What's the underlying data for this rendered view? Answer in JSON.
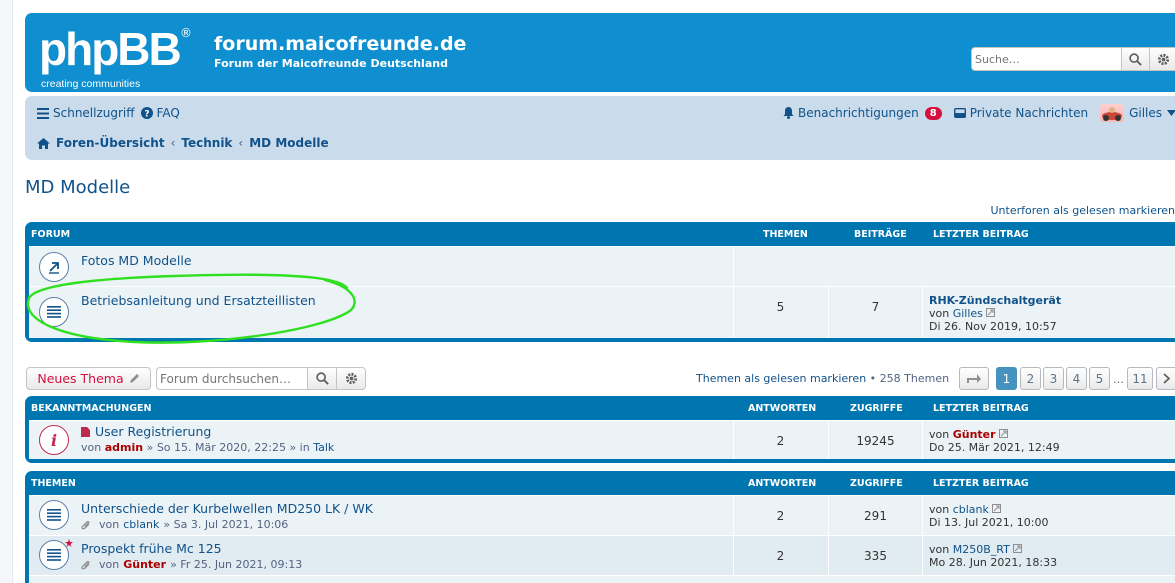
{
  "header": {
    "logo": "phpBB",
    "logo_tag": "creating communities",
    "site_title": "forum.maicofreunde.de",
    "site_desc": "Forum der Maicofreunde Deutschland",
    "search_placeholder": "Suche…"
  },
  "navbar": {
    "quick_links": "Schnellzugriff",
    "faq": "FAQ",
    "notifications": "Benachrichtigungen",
    "notifications_count": "8",
    "private_messages": "Private Nachrichten",
    "username": "Gilles",
    "breadcrumbs": [
      "Foren-Übersicht",
      "Technik",
      "MD Modelle"
    ]
  },
  "page": {
    "title": "MD Modelle",
    "mark_forums_read": "Unterforen als gelesen markieren"
  },
  "forums_block": {
    "headers": {
      "forum": "FORUM",
      "topics": "THEMEN",
      "posts": "BEITRÄGE",
      "last_post": "LETZTER BEITRAG"
    },
    "rows": [
      {
        "title": "Fotos MD Modelle",
        "topics": "",
        "posts": "",
        "last_title": "",
        "last_by": "",
        "last_date": ""
      },
      {
        "title": "Betriebsanleitung und Ersatzteillisten",
        "topics": "5",
        "posts": "7",
        "last_title": "RHK-Zündschaltgerät",
        "by_label": "von",
        "last_by": "Gilles",
        "last_date": "Di 26. Nov 2019, 10:57"
      }
    ]
  },
  "actions": {
    "new_topic": "Neues Thema",
    "forum_search_placeholder": "Forum durchsuchen…",
    "mark_topics_read": "Themen als gelesen markieren",
    "topic_count": "• 258 Themen",
    "pages": [
      "1",
      "2",
      "3",
      "4",
      "5",
      "…",
      "11"
    ]
  },
  "announcements": {
    "headers": {
      "title": "BEKANNTMACHUNGEN",
      "replies": "ANTWORTEN",
      "views": "ZUGRIFFE",
      "last_post": "LETZTER BEITRAG"
    },
    "rows": [
      {
        "title": "User Registrierung",
        "by_label": "von",
        "author": "admin",
        "meta": "» So 15. Mär 2020, 22:25 » in",
        "forum": "Talk",
        "replies": "2",
        "views": "19245",
        "last_by": "Günter",
        "last_date": "Do 25. Mär 2021, 12:49"
      }
    ]
  },
  "topics": {
    "headers": {
      "title": "THEMEN",
      "replies": "ANTWORTEN",
      "views": "ZUGRIFFE",
      "last_post": "LETZTER BEITRAG"
    },
    "rows": [
      {
        "title": "Unterschiede der Kurbelwellen MD250 LK / WK",
        "by_label": "von",
        "author": "cblank",
        "meta": "» Sa 3. Jul 2021, 10:06",
        "replies": "2",
        "views": "291",
        "last_by": "cblank",
        "last_date": "Di 13. Jul 2021, 10:00"
      },
      {
        "title": "Prospekt frühe Mc 125",
        "by_label": "von",
        "author": "Günter",
        "meta": "» Fr 25. Jun 2021, 09:13",
        "replies": "2",
        "views": "335",
        "last_by": "M250B_RT",
        "last_date": "Mo 28. Jun 2021, 18:33"
      }
    ]
  }
}
